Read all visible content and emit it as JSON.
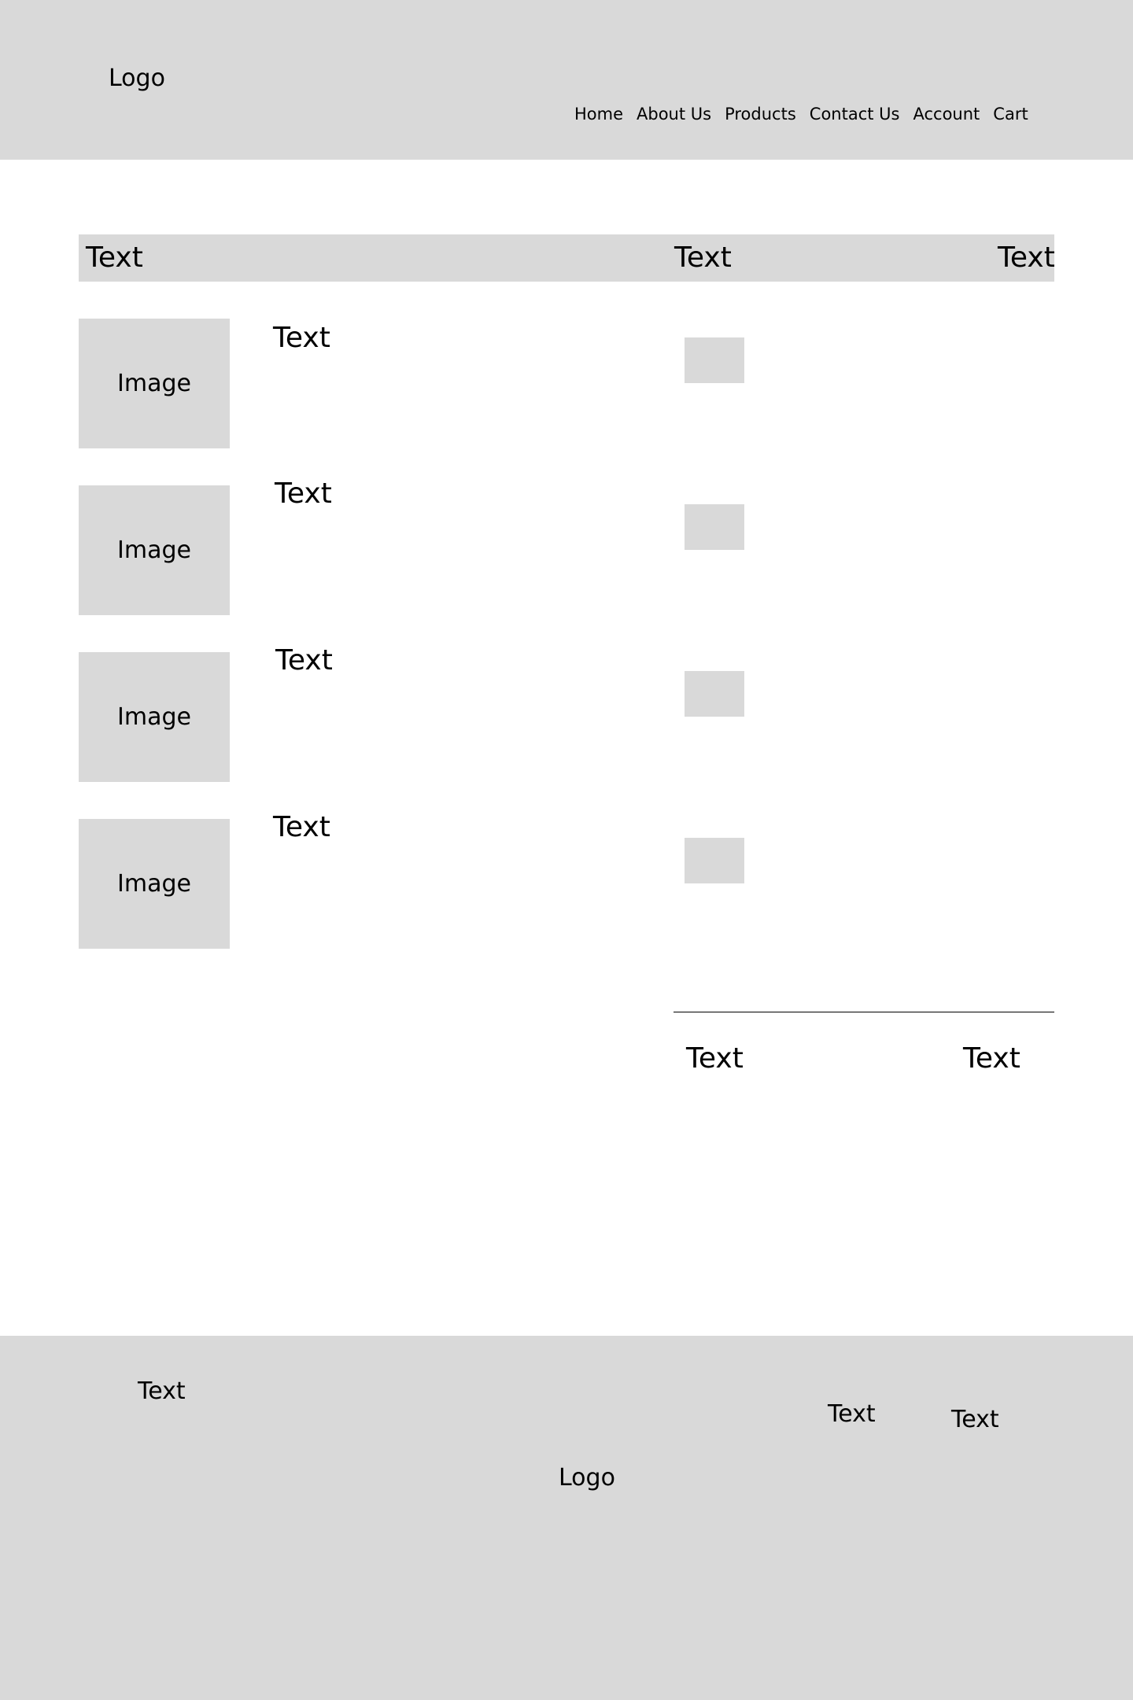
{
  "header": {
    "logo": "Logo",
    "nav": [
      "Home",
      "About Us",
      "Products",
      "Contact Us",
      "Account",
      "Cart"
    ]
  },
  "table": {
    "columns": [
      "Text",
      "Text",
      "Text"
    ]
  },
  "rows": [
    {
      "image_label": "Image",
      "text": "Text"
    },
    {
      "image_label": "Image",
      "text": "Text"
    },
    {
      "image_label": "Image",
      "text": "Text"
    },
    {
      "image_label": "Image",
      "text": "Text"
    }
  ],
  "summary": {
    "left": "Text",
    "right": "Text"
  },
  "footer": {
    "text_left": "Text",
    "logo": "Logo",
    "text_mid": "Text",
    "text_right": "Text"
  },
  "colors": {
    "placeholder_gray": "#d9d9d9",
    "background": "#ffffff",
    "text": "#000000"
  }
}
